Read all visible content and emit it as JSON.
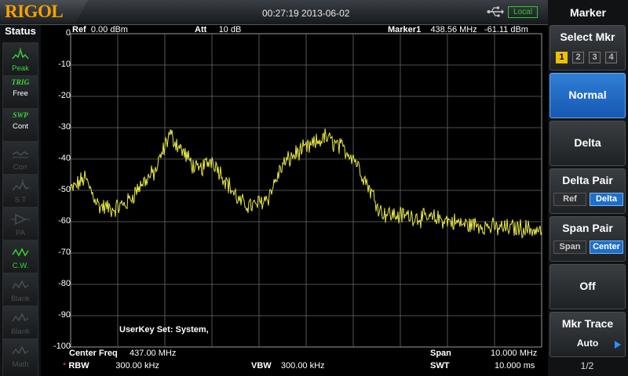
{
  "brand": "RIGOL",
  "datetime": "00:27:19 2013-06-02",
  "remote_status": "Local",
  "status_panel": {
    "title": "Status",
    "items": [
      {
        "label": "Peak",
        "state": "on",
        "icon": "peak-icon"
      },
      {
        "label": "Free",
        "title": "TRIG",
        "state": "on",
        "icon": "trigger-icon"
      },
      {
        "label": "Cont",
        "title": "SWP",
        "state": "on",
        "icon": "sweep-icon"
      },
      {
        "label": "Corr",
        "state": "off",
        "icon": "correction-icon"
      },
      {
        "label": "S.T",
        "state": "off",
        "icon": "source-tracking-icon"
      },
      {
        "label": "PA",
        "state": "off",
        "icon": "preamp-icon"
      },
      {
        "label": "C.W.",
        "state": "on",
        "icon": "cw-icon"
      },
      {
        "label": "Blank",
        "state": "off",
        "icon": "blank-icon"
      },
      {
        "label": "Blank",
        "state": "off",
        "icon": "blank-icon"
      },
      {
        "label": "Math",
        "state": "off",
        "icon": "math-icon"
      }
    ]
  },
  "header": {
    "ref_label": "Ref",
    "ref_value": "0.00 dBm",
    "att_label": "Att",
    "att_value": "10 dB",
    "marker_label": "Marker1",
    "marker_freq": "438.56 MHz",
    "marker_level": "-61.11 dBm"
  },
  "footer": {
    "center_label": "Center Freq",
    "center_value": "437.00 MHz",
    "span_label": "Span",
    "span_value": "10.000 MHz",
    "rbw_flag": "*",
    "rbw_label": "RBW",
    "rbw_value": "300.00 kHz",
    "vbw_label": "VBW",
    "vbw_value": "300.00 kHz",
    "swt_label": "SWT",
    "swt_value": "10.000 ms"
  },
  "annotation": "UserKey Set:    System,",
  "y_ticks": [
    "0",
    "-10",
    "-20",
    "-30",
    "-40",
    "-50",
    "-60",
    "-70",
    "-80",
    "-90",
    "-100"
  ],
  "trace_color": "#e8e84a",
  "chart_data": {
    "type": "line",
    "xlabel": "",
    "ylabel": "",
    "x_range_mhz": [
      432.0,
      442.0
    ],
    "ylim": [
      -100,
      0
    ],
    "grid": true,
    "series": [
      {
        "x": [
          432.0,
          432.3,
          432.6,
          432.9,
          433.2,
          433.5,
          433.8,
          434.1,
          434.4,
          434.7,
          435.0,
          435.3,
          435.6,
          435.9,
          436.2,
          436.5,
          436.8,
          437.1,
          437.4,
          437.7,
          438.0,
          438.3,
          438.6,
          438.9,
          439.2,
          439.5,
          439.8,
          440.1,
          440.4,
          440.7,
          441.0,
          441.3,
          441.6,
          442.0
        ],
        "y": [
          -50,
          -46,
          -55,
          -56,
          -54,
          -48,
          -44,
          -32,
          -38,
          -44,
          -40,
          -47,
          -54,
          -55,
          -52,
          -42,
          -38,
          -36,
          -33,
          -36,
          -39,
          -48,
          -57,
          -58,
          -58,
          -59,
          -59,
          -60,
          -61,
          -61,
          -62,
          -62,
          -62,
          -63
        ]
      }
    ]
  },
  "menu": {
    "title": "Marker",
    "select_mkr": {
      "label": "Select Mkr",
      "numbers": [
        "1",
        "2",
        "3",
        "4"
      ],
      "selected": "1"
    },
    "normal": "Normal",
    "delta": "Delta",
    "delta_pair": {
      "label": "Delta Pair",
      "a": "Ref",
      "b": "Delta"
    },
    "span_pair": {
      "label": "Span Pair",
      "a": "Span",
      "b": "Center"
    },
    "off": "Off",
    "mkr_trace": {
      "label": "Mkr Trace",
      "value": "Auto"
    },
    "page": "1/2"
  }
}
